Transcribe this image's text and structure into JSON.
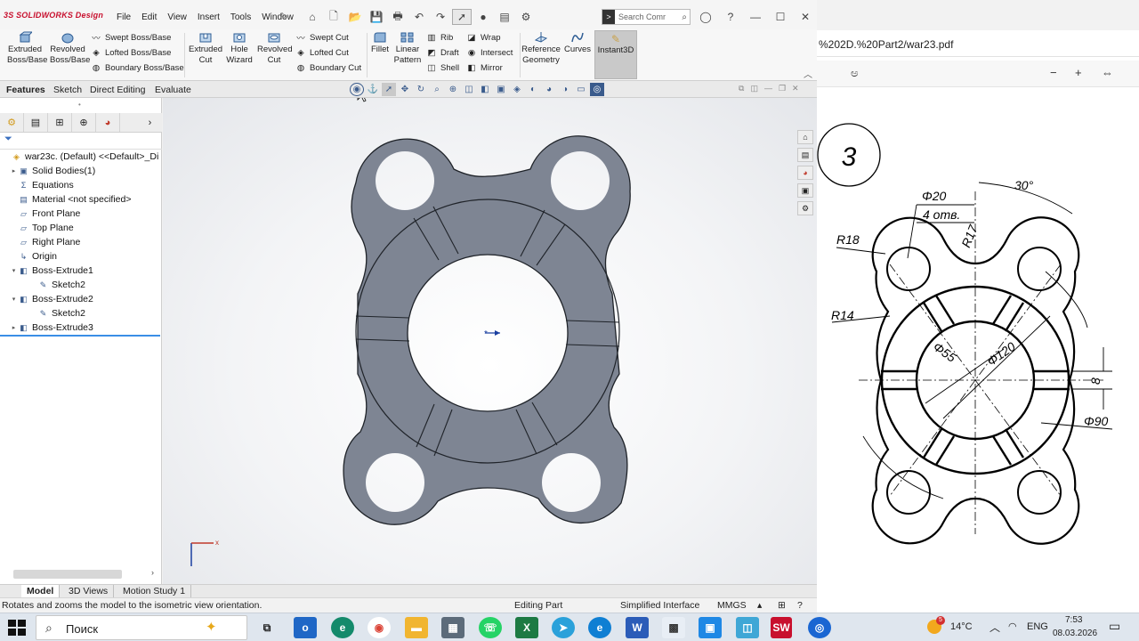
{
  "app": {
    "logo": "SOLIDWORKS Design",
    "menu": [
      "File",
      "Edit",
      "View",
      "Insert",
      "Tools",
      "Window"
    ],
    "search_placeholder": "Search Comr"
  },
  "ribbon": {
    "extruded_boss": "Extruded Boss/Base",
    "revolved_boss": "Revolved Boss/Base",
    "swept_boss": "Swept Boss/Base",
    "lofted_boss": "Lofted Boss/Base",
    "boundary_boss": "Boundary Boss/Base",
    "extruded_cut": "Extruded Cut",
    "hole_wizard": "Hole Wizard",
    "revolved_cut": "Revolved Cut",
    "swept_cut": "Swept Cut",
    "lofted_cut": "Lofted Cut",
    "boundary_cut": "Boundary Cut",
    "fillet": "Fillet",
    "linear_pattern": "Linear Pattern",
    "rib": "Rib",
    "draft": "Draft",
    "shell": "Shell",
    "wrap": "Wrap",
    "intersect": "Intersect",
    "mirror": "Mirror",
    "reference_geometry": "Reference Geometry",
    "curves": "Curves",
    "instant3d": "Instant3D"
  },
  "cmd_tabs": [
    "Features",
    "Sketch",
    "Direct Editing",
    "Evaluate"
  ],
  "tree": [
    {
      "label": "war23c. (Default) <<Default>_Di",
      "icon": "part-icon",
      "expand": "",
      "indent": 0
    },
    {
      "label": "Solid Bodies(1)",
      "icon": "folder-icon",
      "expand": "▸",
      "indent": 1
    },
    {
      "label": "Equations",
      "icon": "equations-icon",
      "expand": "",
      "indent": 1
    },
    {
      "label": "Material <not specified>",
      "icon": "material-icon",
      "expand": "",
      "indent": 1
    },
    {
      "label": "Front Plane",
      "icon": "plane-icon",
      "expand": "",
      "indent": 1
    },
    {
      "label": "Top Plane",
      "icon": "plane-icon",
      "expand": "",
      "indent": 1
    },
    {
      "label": "Right Plane",
      "icon": "plane-icon",
      "expand": "",
      "indent": 1
    },
    {
      "label": "Origin",
      "icon": "origin-icon",
      "expand": "",
      "indent": 1
    },
    {
      "label": "Boss-Extrude1",
      "icon": "feature-icon",
      "expand": "▾",
      "indent": 1
    },
    {
      "label": "Sketch2",
      "icon": "sketch-icon",
      "expand": "",
      "indent": 2
    },
    {
      "label": "Boss-Extrude2",
      "icon": "feature-icon",
      "expand": "▾",
      "indent": 1
    },
    {
      "label": "Sketch2",
      "icon": "sketch-icon",
      "expand": "",
      "indent": 2
    },
    {
      "label": "Boss-Extrude3",
      "icon": "feature-icon",
      "expand": "▸",
      "indent": 1
    }
  ],
  "bottom_tabs": [
    "Model",
    "3D Views",
    "Motion Study 1"
  ],
  "status": {
    "hint": "Rotates and zooms the model to the isometric view orientation.",
    "mode": "Editing Part",
    "interface": "Simplified Interface",
    "units": "MMGS"
  },
  "pdf": {
    "url": "%202D.%20Part2/war23.pdf",
    "zoom_icon": "aa-text-icon",
    "drawing": {
      "number": "3",
      "d20": "Φ20",
      "holes": "4 отв.",
      "angle": "30°",
      "r18": "R18",
      "r17": "R17",
      "r14": "R14",
      "d55": "Φ55",
      "d120": "Φ120",
      "d90": "Φ90",
      "width8": "8"
    }
  },
  "taskbar": {
    "search": "Поиск",
    "weather": "14°C",
    "badge": "5",
    "lang": "ENG",
    "time": "7:53",
    "date": "08.03.2026"
  },
  "colors": {
    "part_fill": "#7e8593",
    "part_stroke": "#2b2f36",
    "accent": "#3a8ee6",
    "taskbar": "#dfe6ee"
  }
}
